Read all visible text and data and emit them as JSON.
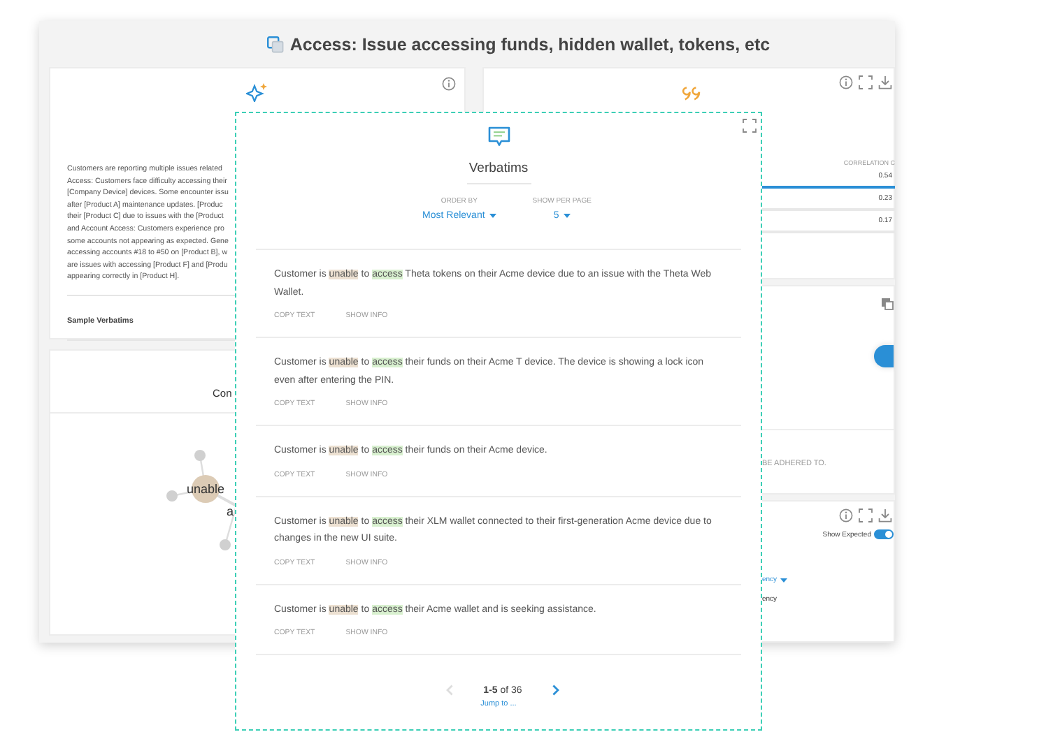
{
  "window": {
    "title": "Access: Issue accessing funds, hidden wallet, tokens, etc"
  },
  "summary_card": {
    "lines": [
      "Customers are reporting multiple issues related",
      "Access: Customers face difficulty accessing their",
      "[Company Device] devices. Some encounter issu",
      "after [Product A] maintenance updates. [Produc",
      "their [Product C] due to issues with the [Product",
      "and Account Access: Customers experience pro",
      "some accounts not appearing as expected. Gene",
      "accessing accounts #18 to #50 on [Product B], w",
      "are issues with accessing [Product F] and [Produ",
      "appearing correctly in [Product H]."
    ],
    "section_label": "Sample Verbatims"
  },
  "network_card": {
    "title": "Con",
    "nodes": [
      {
        "label": "unable",
        "kind": "main"
      },
      {
        "label": "a",
        "kind": "cut"
      }
    ]
  },
  "correlation_card": {
    "header": "CORRELATION C",
    "rows": [
      {
        "value": "0.54",
        "selected": true
      },
      {
        "value": "0.23",
        "selected": false
      },
      {
        "value": "0.17",
        "selected": false
      }
    ]
  },
  "rules_card": {
    "note": "BE ADHERED TO."
  },
  "expected_card": {
    "toggle_label": "Show Expected",
    "toggle_on": true,
    "dropdown": "ency",
    "label": "ency"
  },
  "verbatims": {
    "title": "Verbatims",
    "order_by": {
      "label": "ORDER BY",
      "value": "Most Relevant"
    },
    "per_page": {
      "label": "SHOW PER PAGE",
      "value": "5"
    },
    "items": [
      {
        "segments": [
          {
            "text": "Customer is ",
            "kind": "plain"
          },
          {
            "text": "unable",
            "kind": "term"
          },
          {
            "text": " to ",
            "kind": "plain"
          },
          {
            "text": "access",
            "kind": "pair"
          },
          {
            "text": " Theta tokens on their Acme device due to an issue with the Theta Web Wallet.",
            "kind": "plain"
          }
        ],
        "actions": [
          "COPY TEXT",
          "SHOW INFO"
        ]
      },
      {
        "segments": [
          {
            "text": "Customer is ",
            "kind": "plain"
          },
          {
            "text": "unable",
            "kind": "term"
          },
          {
            "text": " to ",
            "kind": "plain"
          },
          {
            "text": "access",
            "kind": "pair"
          },
          {
            "text": " their funds on their Acme T device. The device is showing a lock icon even after entering the PIN.",
            "kind": "plain"
          }
        ],
        "actions": [
          "COPY TEXT",
          "SHOW INFO"
        ]
      },
      {
        "segments": [
          {
            "text": "Customer is ",
            "kind": "plain"
          },
          {
            "text": "unable",
            "kind": "term"
          },
          {
            "text": " to ",
            "kind": "plain"
          },
          {
            "text": "access",
            "kind": "pair"
          },
          {
            "text": " their funds on their Acme device.",
            "kind": "plain"
          }
        ],
        "actions": [
          "COPY TEXT",
          "SHOW INFO"
        ]
      },
      {
        "segments": [
          {
            "text": "Customer is ",
            "kind": "plain"
          },
          {
            "text": "unable",
            "kind": "term"
          },
          {
            "text": " to ",
            "kind": "plain"
          },
          {
            "text": "access",
            "kind": "pair"
          },
          {
            "text": " their XLM wallet connected to their first-generation Acme device due to changes in the new UI suite.",
            "kind": "plain"
          }
        ],
        "actions": [
          "COPY TEXT",
          "SHOW INFO"
        ]
      },
      {
        "segments": [
          {
            "text": "Customer is ",
            "kind": "plain"
          },
          {
            "text": "unable",
            "kind": "term"
          },
          {
            "text": " to ",
            "kind": "plain"
          },
          {
            "text": "access",
            "kind": "pair"
          },
          {
            "text": " their Acme wallet and is seeking assistance.",
            "kind": "plain"
          }
        ],
        "actions": [
          "COPY TEXT",
          "SHOW INFO"
        ]
      }
    ],
    "pagination": {
      "range": "**1-5** of 36",
      "prev_disabled": true,
      "next_disabled": false,
      "jump": "Jump to ..."
    }
  }
}
